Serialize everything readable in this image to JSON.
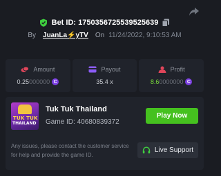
{
  "bet": {
    "id_label": "Bet ID: 1750356725539525639",
    "by_label": "By",
    "username": "JuanLa⚡yTV",
    "on_label": "On",
    "datetime": "11/24/2022, 9:10:53 AM"
  },
  "stats": {
    "amount": {
      "label": "Amount",
      "value_main": "0.25",
      "value_dim": "000000",
      "color": "#e0455a"
    },
    "payout": {
      "label": "Payout",
      "value": "35.4 x",
      "color": "#8b5cf6"
    },
    "profit": {
      "label": "Profit",
      "value_main": "8.6",
      "value_dim": "0000000",
      "color": "#e0455a"
    }
  },
  "game": {
    "name": "Tuk Tuk Thailand",
    "id_label": "Game ID: 40680839372",
    "thumb_line1": "TUK TUK",
    "thumb_line2": "THAILAND",
    "play_label": "Play Now"
  },
  "support": {
    "help_text": "Any issues, please contact the customer service for help and provide the game ID.",
    "button_label": "Live Support"
  },
  "coin_symbol": "C",
  "colors": {
    "accent_green": "#45c11f",
    "profit_green": "#78d83b",
    "coin_purple": "#7a3ee0",
    "verified_green": "#3fcf3f"
  }
}
